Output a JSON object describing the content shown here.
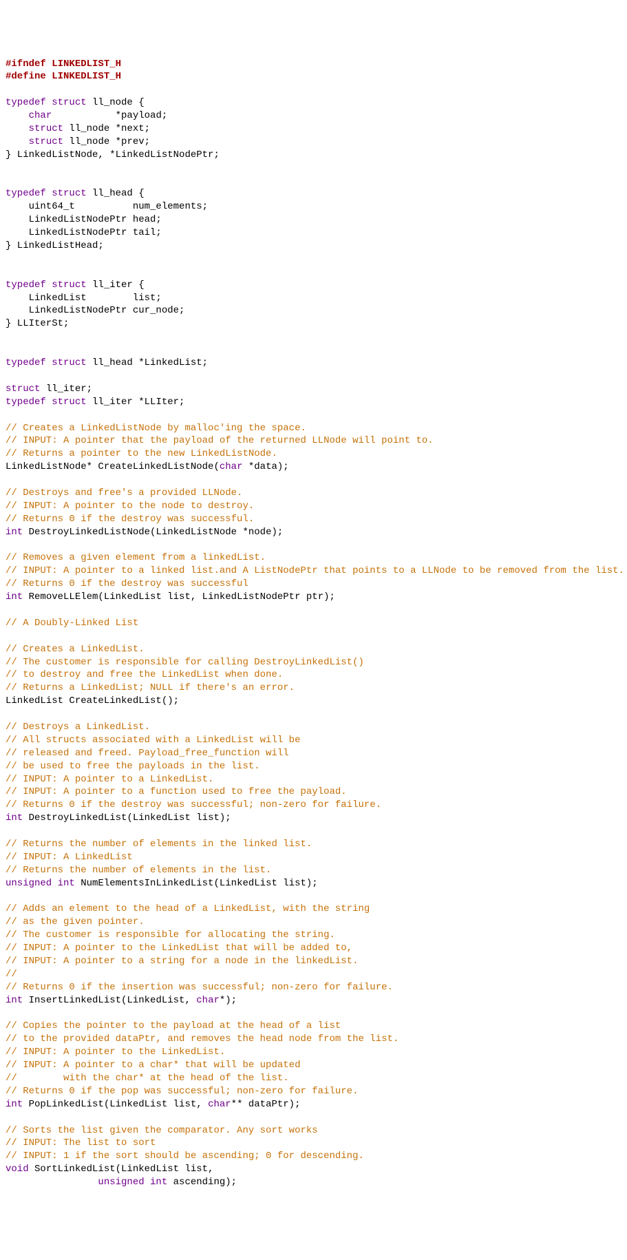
{
  "lines": [
    [
      {
        "cls": "pre",
        "t": "#ifndef LINKEDLIST_H"
      }
    ],
    [
      {
        "cls": "pre",
        "t": "#define LINKEDLIST_H"
      }
    ],
    [],
    [
      {
        "cls": "kw",
        "t": "typedef struct"
      },
      {
        "cls": "pl",
        "t": " ll_node {"
      }
    ],
    [
      {
        "cls": "pl",
        "t": "    "
      },
      {
        "cls": "kw",
        "t": "char"
      },
      {
        "cls": "pl",
        "t": "           *payload;"
      }
    ],
    [
      {
        "cls": "pl",
        "t": "    "
      },
      {
        "cls": "kw",
        "t": "struct"
      },
      {
        "cls": "pl",
        "t": " ll_node *next;"
      }
    ],
    [
      {
        "cls": "pl",
        "t": "    "
      },
      {
        "cls": "kw",
        "t": "struct"
      },
      {
        "cls": "pl",
        "t": " ll_node *prev;"
      }
    ],
    [
      {
        "cls": "pl",
        "t": "} LinkedListNode, *LinkedListNodePtr;"
      }
    ],
    [],
    [],
    [
      {
        "cls": "kw",
        "t": "typedef struct"
      },
      {
        "cls": "pl",
        "t": " ll_head {"
      }
    ],
    [
      {
        "cls": "pl",
        "t": "    uint64_t          num_elements;"
      }
    ],
    [
      {
        "cls": "pl",
        "t": "    LinkedListNodePtr head;"
      }
    ],
    [
      {
        "cls": "pl",
        "t": "    LinkedListNodePtr tail;"
      }
    ],
    [
      {
        "cls": "pl",
        "t": "} LinkedListHead;"
      }
    ],
    [],
    [],
    [
      {
        "cls": "kw",
        "t": "typedef struct"
      },
      {
        "cls": "pl",
        "t": " ll_iter {"
      }
    ],
    [
      {
        "cls": "pl",
        "t": "    LinkedList        list;"
      }
    ],
    [
      {
        "cls": "pl",
        "t": "    LinkedListNodePtr cur_node;"
      }
    ],
    [
      {
        "cls": "pl",
        "t": "} LLIterSt;"
      }
    ],
    [],
    [],
    [
      {
        "cls": "kw",
        "t": "typedef struct"
      },
      {
        "cls": "pl",
        "t": " ll_head *LinkedList;"
      }
    ],
    [],
    [
      {
        "cls": "kw",
        "t": "struct"
      },
      {
        "cls": "pl",
        "t": " ll_iter;"
      }
    ],
    [
      {
        "cls": "kw",
        "t": "typedef struct"
      },
      {
        "cls": "pl",
        "t": " ll_iter *LLIter;"
      }
    ],
    [],
    [
      {
        "cls": "cm",
        "t": "// Creates a LinkedListNode by malloc'ing the space."
      }
    ],
    [
      {
        "cls": "cm",
        "t": "// INPUT: A pointer that the payload of the returned LLNode will point to."
      }
    ],
    [
      {
        "cls": "cm",
        "t": "// Returns a pointer to the new LinkedListNode."
      }
    ],
    [
      {
        "cls": "pl",
        "t": "LinkedListNode* CreateLinkedListNode("
      },
      {
        "cls": "kw",
        "t": "char"
      },
      {
        "cls": "pl",
        "t": " *data);"
      }
    ],
    [],
    [
      {
        "cls": "cm",
        "t": "// Destroys and free's a provided LLNode."
      }
    ],
    [
      {
        "cls": "cm",
        "t": "// INPUT: A pointer to the node to destroy."
      }
    ],
    [
      {
        "cls": "cm",
        "t": "// Returns 0 if the destroy was successful."
      }
    ],
    [
      {
        "cls": "kw",
        "t": "int"
      },
      {
        "cls": "pl",
        "t": " DestroyLinkedListNode(LinkedListNode *node);"
      }
    ],
    [],
    [
      {
        "cls": "cm",
        "t": "// Removes a given element from a linkedList."
      }
    ],
    [
      {
        "cls": "cm",
        "t": "// INPUT: A pointer to a linked list.and A ListNodePtr that points to a LLNode to be removed from the list."
      }
    ],
    [
      {
        "cls": "cm",
        "t": "// Returns 0 if the destroy was successful"
      }
    ],
    [
      {
        "cls": "kw",
        "t": "int"
      },
      {
        "cls": "pl",
        "t": " RemoveLLElem(LinkedList list, LinkedListNodePtr ptr);"
      }
    ],
    [],
    [
      {
        "cls": "cm",
        "t": "// A Doubly-Linked List"
      }
    ],
    [],
    [
      {
        "cls": "cm",
        "t": "// Creates a LinkedList."
      }
    ],
    [
      {
        "cls": "cm",
        "t": "// The customer is responsible for calling DestroyLinkedList()"
      }
    ],
    [
      {
        "cls": "cm",
        "t": "// to destroy and free the LinkedList when done."
      }
    ],
    [
      {
        "cls": "cm",
        "t": "// Returns a LinkedList; NULL if there's an error."
      }
    ],
    [
      {
        "cls": "pl",
        "t": "LinkedList CreateLinkedList();"
      }
    ],
    [],
    [
      {
        "cls": "cm",
        "t": "// Destroys a LinkedList."
      }
    ],
    [
      {
        "cls": "cm",
        "t": "// All structs associated with a LinkedList will be"
      }
    ],
    [
      {
        "cls": "cm",
        "t": "// released and freed. Payload_free_function will"
      }
    ],
    [
      {
        "cls": "cm",
        "t": "// be used to free the payloads in the list."
      }
    ],
    [
      {
        "cls": "cm",
        "t": "// INPUT: A pointer to a LinkedList."
      }
    ],
    [
      {
        "cls": "cm",
        "t": "// INPUT: A pointer to a function used to free the payload."
      }
    ],
    [
      {
        "cls": "cm",
        "t": "// Returns 0 if the destroy was successful; non-zero for failure."
      }
    ],
    [
      {
        "cls": "kw",
        "t": "int"
      },
      {
        "cls": "pl",
        "t": " DestroyLinkedList(LinkedList list);"
      }
    ],
    [],
    [
      {
        "cls": "cm",
        "t": "// Returns the number of elements in the linked list."
      }
    ],
    [
      {
        "cls": "cm",
        "t": "// INPUT: A LinkedList"
      }
    ],
    [
      {
        "cls": "cm",
        "t": "// Returns the number of elements in the list."
      }
    ],
    [
      {
        "cls": "kw",
        "t": "unsigned int"
      },
      {
        "cls": "pl",
        "t": " NumElementsInLinkedList(LinkedList list);"
      }
    ],
    [],
    [
      {
        "cls": "cm",
        "t": "// Adds an element to the head of a LinkedList, with the string"
      }
    ],
    [
      {
        "cls": "cm",
        "t": "// as the given pointer."
      }
    ],
    [
      {
        "cls": "cm",
        "t": "// The customer is responsible for allocating the string."
      }
    ],
    [
      {
        "cls": "cm",
        "t": "// INPUT: A pointer to the LinkedList that will be added to,"
      }
    ],
    [
      {
        "cls": "cm",
        "t": "// INPUT: A pointer to a string for a node in the linkedList."
      }
    ],
    [
      {
        "cls": "cm",
        "t": "//"
      }
    ],
    [
      {
        "cls": "cm",
        "t": "// Returns 0 if the insertion was successful; non-zero for failure."
      }
    ],
    [
      {
        "cls": "kw",
        "t": "int"
      },
      {
        "cls": "pl",
        "t": " InsertLinkedList(LinkedList, "
      },
      {
        "cls": "kw",
        "t": "char"
      },
      {
        "cls": "pl",
        "t": "*);"
      }
    ],
    [],
    [
      {
        "cls": "cm",
        "t": "// Copies the pointer to the payload at the head of a list"
      }
    ],
    [
      {
        "cls": "cm",
        "t": "// to the provided dataPtr, and removes the head node from the list."
      }
    ],
    [
      {
        "cls": "cm",
        "t": "// INPUT: A pointer to the LinkedList."
      }
    ],
    [
      {
        "cls": "cm",
        "t": "// INPUT: A pointer to a char* that will be updated"
      }
    ],
    [
      {
        "cls": "cm",
        "t": "//        with the char* at the head of the list."
      }
    ],
    [
      {
        "cls": "cm",
        "t": "// Returns 0 if the pop was successful; non-zero for failure."
      }
    ],
    [
      {
        "cls": "kw",
        "t": "int"
      },
      {
        "cls": "pl",
        "t": " PopLinkedList(LinkedList list, "
      },
      {
        "cls": "kw",
        "t": "char"
      },
      {
        "cls": "pl",
        "t": "** dataPtr);"
      }
    ],
    [],
    [
      {
        "cls": "cm",
        "t": "// Sorts the list given the comparator. Any sort works"
      }
    ],
    [
      {
        "cls": "cm",
        "t": "// INPUT: The list to sort"
      }
    ],
    [
      {
        "cls": "cm",
        "t": "// INPUT: 1 if the sort should be ascending; 0 for descending."
      }
    ],
    [
      {
        "cls": "kw",
        "t": "void"
      },
      {
        "cls": "pl",
        "t": " SortLinkedList(LinkedList list,"
      }
    ],
    [
      {
        "cls": "pl",
        "t": "                "
      },
      {
        "cls": "kw",
        "t": "unsigned int"
      },
      {
        "cls": "pl",
        "t": " ascending);"
      }
    ]
  ]
}
